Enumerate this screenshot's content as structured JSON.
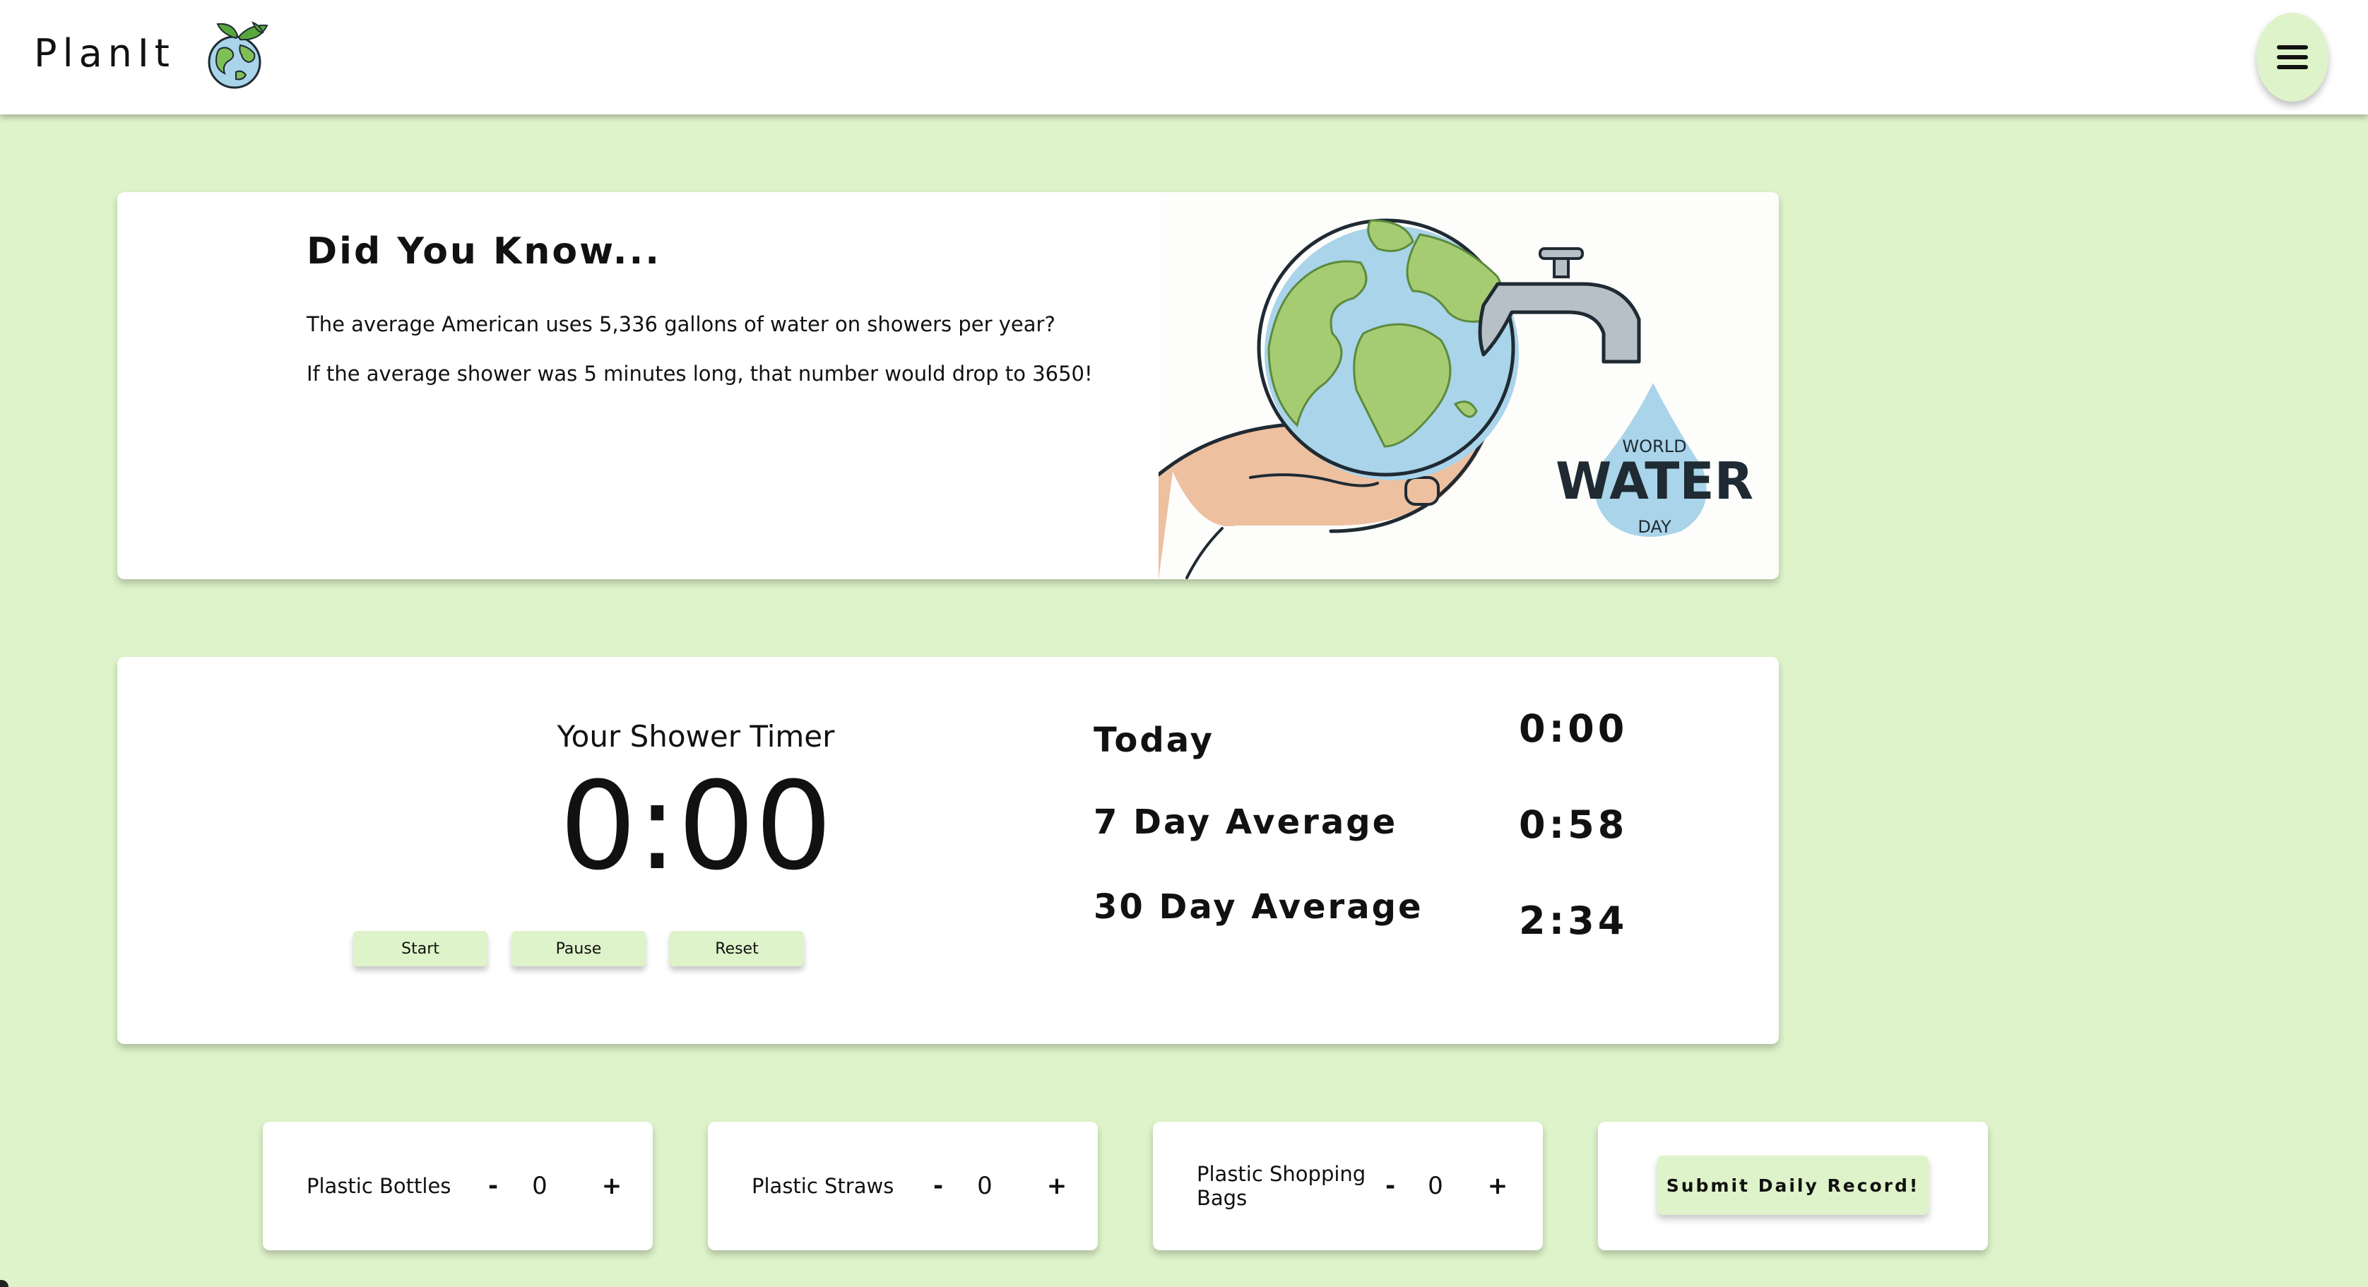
{
  "app": {
    "name": "PlanIt",
    "logo_icon": "earth-with-leaves-icon",
    "menu_icon": "hamburger-menu-icon"
  },
  "did_you_know": {
    "title": "Did You Know...",
    "facts": [
      "The average American uses 5,336 gallons of water on showers per year?",
      "If the average shower was 5 minutes long, that number would drop to 3650!"
    ],
    "illustration": {
      "description_icon": "world-water-day-illustration",
      "badge_lines": [
        "WORLD",
        "WATER",
        "DAY"
      ]
    }
  },
  "timer": {
    "label": "Your Shower Timer",
    "display": "0:00",
    "buttons": [
      "Start",
      "Pause",
      "Reset"
    ]
  },
  "stats": [
    {
      "label": "Today",
      "value": "0:00"
    },
    {
      "label": "7 Day Average",
      "value": "0:58"
    },
    {
      "label": "30 Day Average",
      "value": "2:34"
    }
  ],
  "counters": [
    {
      "label": "Plastic Bottles",
      "minus": "-",
      "value": "0",
      "plus": "+"
    },
    {
      "label": "Plastic Straws",
      "minus": "-",
      "value": "0",
      "plus": "+"
    },
    {
      "label": "Plastic Shopping Bags",
      "minus": "-",
      "value": "0",
      "plus": "+"
    }
  ],
  "submit": {
    "label": "Submit Daily Record!"
  },
  "colors": {
    "background": "#def3c9",
    "accent": "#def3c9",
    "card": "#ffffff",
    "water_blue": "#a9d4ea",
    "land_green": "#a6cc73",
    "skin": "#edc0a0"
  }
}
